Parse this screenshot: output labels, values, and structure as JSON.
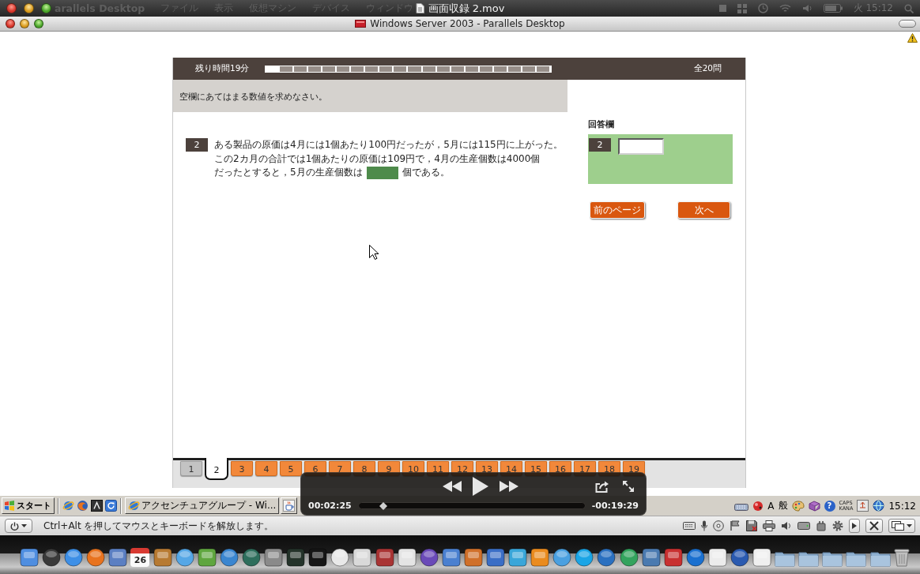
{
  "menu_bar": {
    "app_name": "arallels Desktop",
    "menus": [
      "ファイル",
      "表示",
      "仮想マシン",
      "デバイス",
      "ウィンドウ"
    ],
    "clock": "火 15:12"
  },
  "player": {
    "title": "画面収録 2.mov",
    "elapsed": "00:02:25",
    "remaining": "-00:19:29",
    "position": {
      "level": 0.11
    }
  },
  "vm_window": {
    "title": "Windows Server 2003 - Parallels Desktop"
  },
  "test": {
    "timer": "残り時間19分",
    "progress": {
      "level": 0.05
    },
    "total": "全20問",
    "instruction": "空欄にあてはまる数値を求めなさい。",
    "question": {
      "number": "2",
      "lines": [
        "ある製品の原価は4月には1個あたり100円だったが，5月には115円に上がった。",
        "この2カ月の合計では1個あたりの原価は109円で，4月の生産個数は4000個",
        "だったとすると，5月の生産個数は"
      ],
      "text_after": "個である。"
    },
    "answer_panel": {
      "label": "回答欄",
      "number": "2"
    },
    "buttons": [
      {
        "label": "前のページ"
      },
      {
        "label": "次へ"
      }
    ],
    "page_tabs": [
      {
        "label": "1",
        "selected": false,
        "visited": true
      },
      {
        "label": "2",
        "selected": true,
        "visited": false
      },
      {
        "label": "3",
        "selected": false,
        "visited": false
      },
      {
        "label": "4",
        "selected": false,
        "visited": false
      },
      {
        "label": "5",
        "selected": false,
        "visited": false
      },
      {
        "label": "6",
        "selected": false,
        "visited": false
      },
      {
        "label": "7",
        "selected": false,
        "visited": false
      },
      {
        "label": "8",
        "selected": false,
        "visited": false
      },
      {
        "label": "9",
        "selected": false,
        "visited": false
      },
      {
        "label": "10",
        "selected": false,
        "visited": false
      },
      {
        "label": "11",
        "selected": false,
        "visited": false
      },
      {
        "label": "12",
        "selected": false,
        "visited": false
      },
      {
        "label": "13",
        "selected": false,
        "visited": false
      },
      {
        "label": "14",
        "selected": false,
        "visited": false
      },
      {
        "label": "15",
        "selected": false,
        "visited": false
      },
      {
        "label": "16",
        "selected": false,
        "visited": false
      },
      {
        "label": "17",
        "selected": false,
        "visited": false
      },
      {
        "label": "18",
        "selected": false,
        "visited": false
      },
      {
        "label": "19",
        "selected": false,
        "visited": false
      }
    ]
  },
  "taskbar": {
    "start": "スタート",
    "tasks": [
      {
        "kind": "labeled",
        "label": "アクセンチュアグループ - Wi..."
      },
      {
        "kind": "icon"
      }
    ],
    "ime": {
      "mode": "A",
      "conversion": "般"
    },
    "help": "?",
    "lock_keys": [
      "CAPS",
      "KANA"
    ],
    "clock": "15:12"
  },
  "status_bar": {
    "hint": "Ctrl+Alt を押してマウスとキーボードを解放します。"
  },
  "dock": {
    "calendar_day": "26"
  }
}
